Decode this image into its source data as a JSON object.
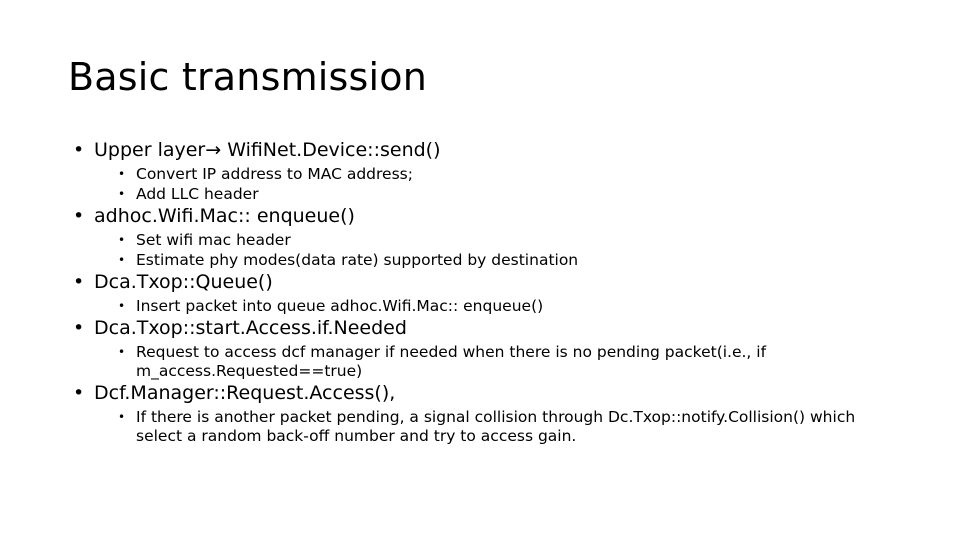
{
  "slide": {
    "title": "Basic transmission",
    "bullet_glyph": "•",
    "background_color": "#ffffff",
    "text_color": "#000000",
    "groups": [
      {
        "heading": "Upper layer→ WifiNet.Device::send()",
        "subitems": [
          "Convert IP address to MAC address;",
          "Add LLC header"
        ]
      },
      {
        "heading": "adhoc.Wifi.Mac:: enqueue()",
        "subitems": [
          "Set wifi mac header",
          "Estimate phy modes(data rate) supported by destination"
        ]
      },
      {
        "heading": "Dca.Txop::Queue()",
        "subitems": [
          "Insert packet into queue adhoc.Wifi.Mac:: enqueue()"
        ]
      },
      {
        "heading": "Dca.Txop::start.Access.if.Needed",
        "subitems": [
          "Request to access dcf manager if needed when  there is no pending packet(i.e., if m_access.Requested==true)"
        ]
      },
      {
        "heading": "Dcf.Manager::Request.Access(),",
        "subitems": [
          "If there is another packet pending, a signal collision through Dc.Txop::notify.Collision() which select a random back-off number and try to access gain."
        ]
      }
    ]
  }
}
